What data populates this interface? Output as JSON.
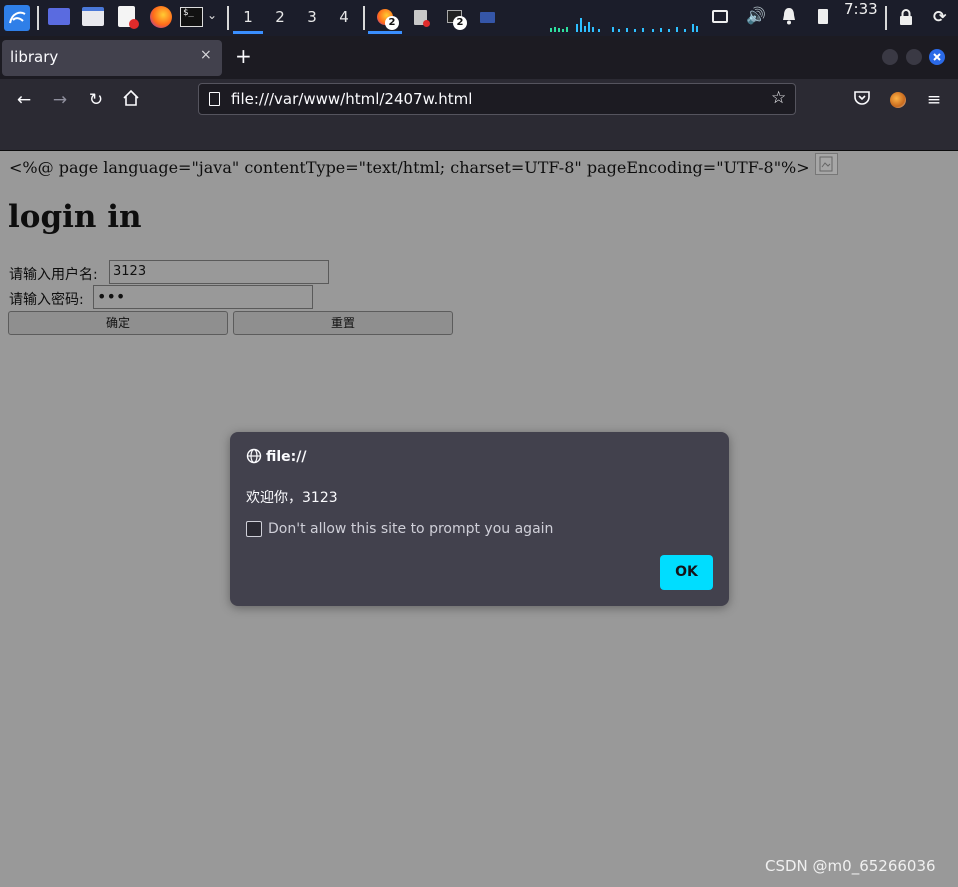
{
  "taskbar": {
    "workspaces": [
      {
        "label": "1",
        "active": true
      },
      {
        "label": "2",
        "active": false
      },
      {
        "label": "3",
        "active": false
      },
      {
        "label": "4",
        "active": false
      }
    ],
    "firefox_badge": "2",
    "terminal_badge": "2",
    "clock": "7:33",
    "accent_color": "#3a8fff"
  },
  "browser": {
    "tab_title": "library",
    "tab_close": "×",
    "new_tab": "+",
    "url": "file:///var/www/html/2407w.html"
  },
  "page": {
    "jsp_directive": "<%@ page language=\"java\" contentType=\"text/html; charset=UTF-8\" pageEncoding=\"UTF-8\"%>",
    "heading": "login in",
    "username_label": "请输入用户名:",
    "username_value": "3123",
    "password_label": "请输入密码:",
    "password_value": "•••",
    "submit_label": "确定",
    "reset_label": "重置"
  },
  "dialog": {
    "origin": "file://",
    "message": "欢迎你，3123",
    "checkbox_label": "Don't allow this site to prompt you again",
    "ok_label": "OK",
    "ok_color": "#00ddff"
  },
  "watermark": "CSDN @m0_65266036"
}
